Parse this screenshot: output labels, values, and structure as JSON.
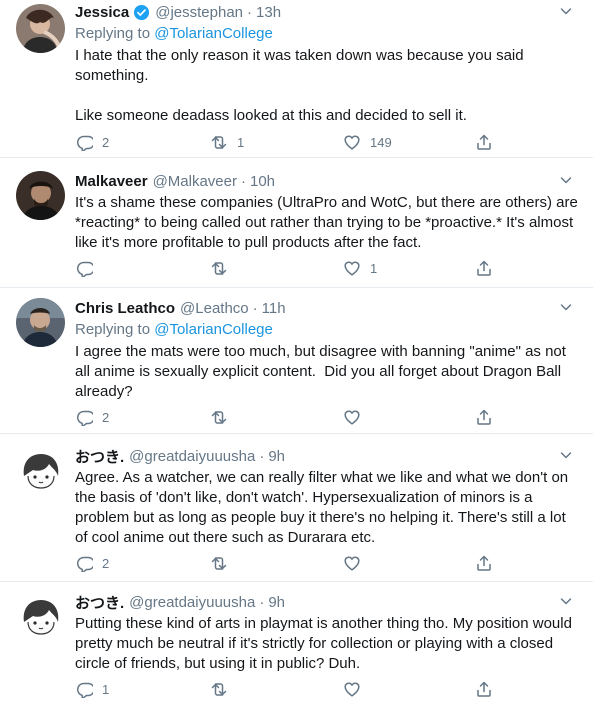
{
  "tweets": [
    {
      "name": "Jessica",
      "verified": true,
      "handle": "@jesstephan",
      "time": "13h",
      "reply_prefix": "Replying to ",
      "reply_to": "@TolarianCollege",
      "text": "I hate that the only reason it was taken down was because you said\nsomething.\n\nLike someone deadass looked at this and decided to sell it.",
      "replies": "2",
      "retweets": "1",
      "likes": "149"
    },
    {
      "name": "Malkaveer",
      "verified": false,
      "handle": "@Malkaveer",
      "time": "10h",
      "reply_prefix": "",
      "reply_to": "",
      "text": "It's a shame these companies (UltraPro and WotC, but there are others) are\n*reacting* to being called out rather than trying to be *proactive.* It's almost\nlike it's more profitable to pull products after the fact.",
      "replies": "",
      "retweets": "",
      "likes": "1"
    },
    {
      "name": "Chris Leathco",
      "verified": false,
      "handle": "@Leathco",
      "time": "11h",
      "reply_prefix": "Replying to ",
      "reply_to": "@TolarianCollege",
      "text": "I agree the mats were too much, but disagree with banning \"anime\" as not\nall anime is sexually explicit content.  Did you all forget about Dragon Ball\nalready?",
      "replies": "2",
      "retweets": "",
      "likes": ""
    },
    {
      "name": "おつき.",
      "verified": false,
      "handle": "@greatdaiyuuusha",
      "time": "9h",
      "reply_prefix": "",
      "reply_to": "",
      "text": "Agree. As a watcher, we can really filter what we like and what we don't on\nthe basis of 'don't like, don't watch'. Hypersexualization of minors is a\nproblem but as long as people buy it there's no helping it. There's still a lot\nof cool anime out there such as Durarara etc.",
      "replies": "2",
      "retweets": "",
      "likes": ""
    },
    {
      "name": "おつき.",
      "verified": false,
      "handle": "@greatdaiyuuusha",
      "time": "9h",
      "reply_prefix": "",
      "reply_to": "",
      "text": "Putting these kind of arts in playmat is another thing tho. My position would\npretty much be neutral if it's strictly for collection or playing with a closed\ncircle of friends, but using it in public? Duh.",
      "replies": "1",
      "retweets": "",
      "likes": ""
    }
  ],
  "separator": "·",
  "icons": {
    "reply": "reply-icon",
    "retweet": "retweet-icon",
    "like": "like-icon",
    "share": "share-icon",
    "more": "chevron-down-icon",
    "verified": "verified-badge-icon"
  },
  "colors": {
    "text": "#14171a",
    "secondary": "#657786",
    "link": "#1b95e0",
    "verified": "#1da1f2",
    "divider": "#e6ecf0"
  }
}
